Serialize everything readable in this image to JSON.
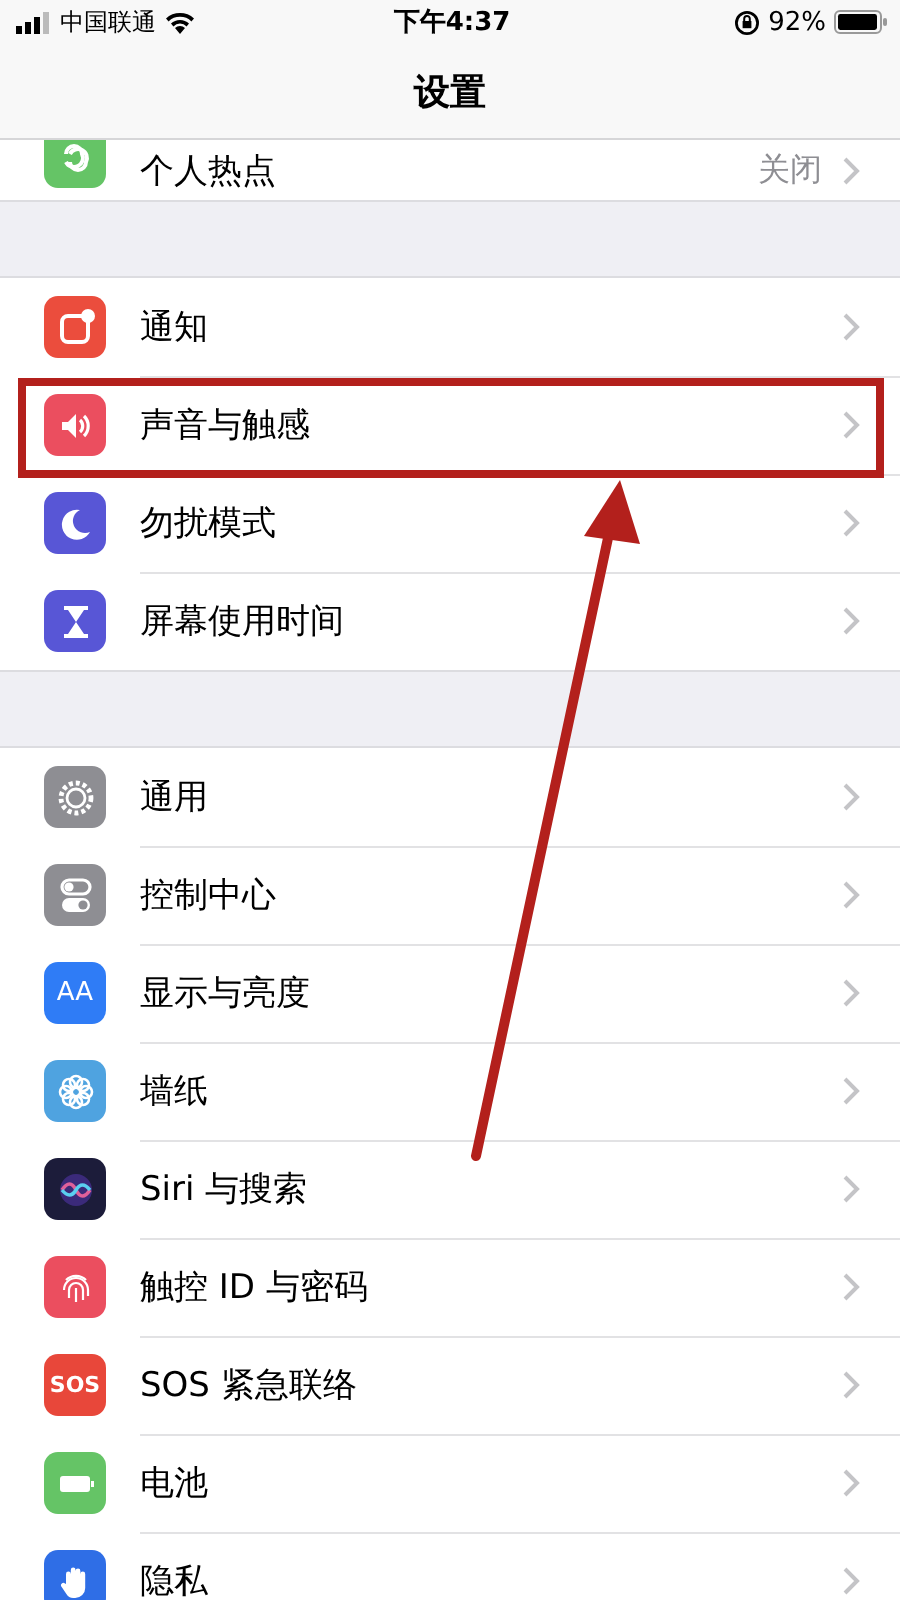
{
  "status_bar": {
    "carrier": "中国联通",
    "time": "下午4:37",
    "battery": "92%"
  },
  "nav": {
    "title": "设置"
  },
  "groups": [
    {
      "items": [
        {
          "kind": "hotspot",
          "label": "个人热点",
          "value": "关闭",
          "highlighted": false
        }
      ]
    },
    {
      "items": [
        {
          "kind": "notification",
          "label": "通知",
          "highlighted": false
        },
        {
          "kind": "sound",
          "label": "声音与触感",
          "highlighted": true
        },
        {
          "kind": "moon",
          "label": "勿扰模式",
          "highlighted": false
        },
        {
          "kind": "hourglass",
          "label": "屏幕使用时间",
          "highlighted": false
        }
      ]
    },
    {
      "items": [
        {
          "kind": "gear",
          "label": "通用",
          "highlighted": false
        },
        {
          "kind": "toggles",
          "label": "控制中心",
          "highlighted": false
        },
        {
          "kind": "text",
          "icon_text": "AA",
          "label": "显示与亮度",
          "highlighted": false
        },
        {
          "kind": "flower",
          "label": "墙纸",
          "highlighted": false
        },
        {
          "kind": "siri",
          "label": "Siri 与搜索",
          "highlighted": false
        },
        {
          "kind": "fingerprint",
          "label": "触控 ID 与密码",
          "highlighted": false
        },
        {
          "kind": "sos",
          "icon_text": "SOS",
          "label": "SOS 紧急联络",
          "highlighted": false
        },
        {
          "kind": "battery",
          "label": "电池",
          "highlighted": false
        },
        {
          "kind": "hand",
          "label": "隐私",
          "highlighted": false
        }
      ]
    }
  ],
  "annotation_arrow": true
}
